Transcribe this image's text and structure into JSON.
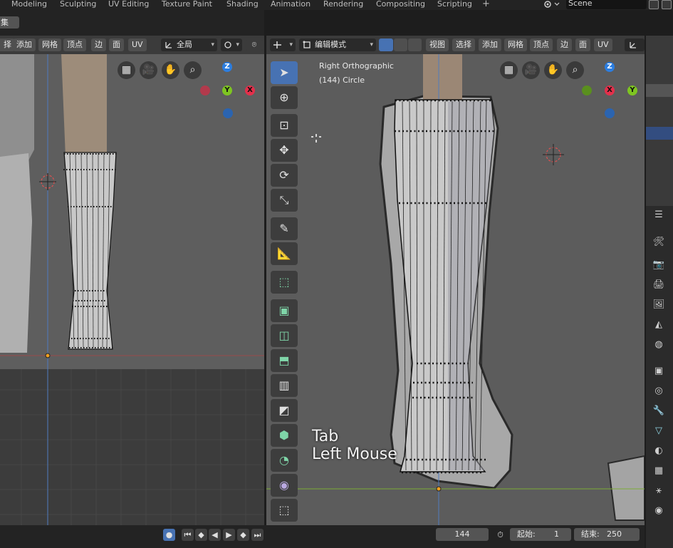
{
  "workspaces": {
    "tabs": [
      "Modeling",
      "Sculpting",
      "UV Editing",
      "Texture Paint",
      "Shading",
      "Animation",
      "Rendering",
      "Compositing",
      "Scripting"
    ],
    "add_tab": "+"
  },
  "scene": {
    "label": "Scene"
  },
  "left_area": {
    "chip_label": "集",
    "header": {
      "cut_label": "择",
      "menus": [
        "添加",
        "网格",
        "顶点",
        "边",
        "面",
        "UV"
      ],
      "orientation_label": "全局"
    }
  },
  "right_area": {
    "header": {
      "mode_label": "编辑模式",
      "menus": [
        "视图",
        "选择",
        "添加",
        "网格",
        "顶点",
        "边",
        "面",
        "UV"
      ]
    },
    "view_name": "Right Orthographic",
    "object_info": "(144) Circle",
    "shortcut_overlay": [
      "Tab",
      "Left Mouse"
    ]
  },
  "gizmo_axes": {
    "x": "X",
    "y": "Y",
    "z": "Z"
  },
  "timeline": {
    "current_frame": "144",
    "start_label": "起始:",
    "start_value": "1",
    "end_label": "结束:",
    "end_value": "250"
  },
  "icons": {
    "tools": [
      "select-box-icon",
      "cursor-icon",
      "move-icon",
      "translate-icon",
      "rotate-icon",
      "scale-icon",
      "annotate-icon",
      "measure-icon",
      "add-cube-icon",
      "extrude-icon",
      "inset-icon",
      "bevel-icon",
      "loop-cut-icon",
      "knife-icon",
      "poly-build-icon",
      "spin-icon",
      "smooth-icon",
      "shrink-fatten-icon"
    ],
    "props": [
      "tool-icon",
      "render-icon",
      "output-icon",
      "view-layer-icon",
      "scene-icon",
      "world-icon",
      "object-icon",
      "modifier-icon",
      "particles-icon",
      "physics-icon",
      "constraints-icon",
      "data-icon",
      "material-icon",
      "texture-icon"
    ]
  },
  "colors": {
    "active_tool": "#4772b3",
    "x_axis": "#e3304b",
    "y_axis": "#7ec521",
    "z_axis": "#2b7de0",
    "viewport_bg": "#545454"
  }
}
